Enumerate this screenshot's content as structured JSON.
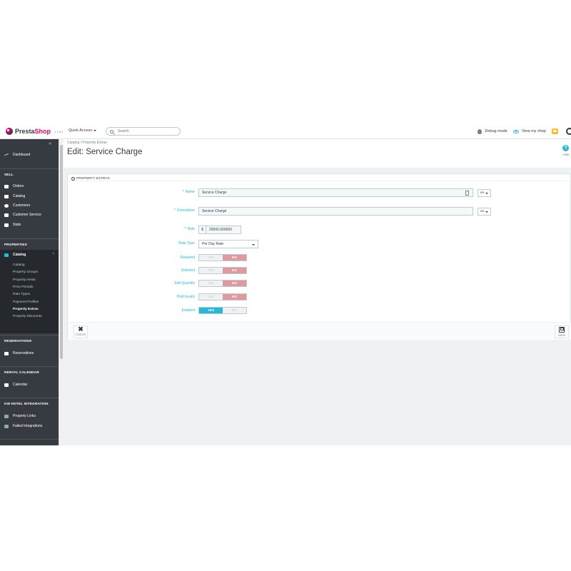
{
  "header": {
    "brand_presta": "Presta",
    "brand_shop": "Shop",
    "version": "1.7.4.2",
    "quick_access": "Quick Access",
    "search_placeholder": "Search",
    "debug_mode": "Debug mode",
    "view_shop": "View my shop"
  },
  "sidebar": {
    "collapse": "«",
    "dashboard": "Dashboard",
    "sell_title": "SELL",
    "sell_items": [
      "Orders",
      "Catalog",
      "Customers",
      "Customer Service",
      "Stats"
    ],
    "properties_title": "PROPERTIES",
    "catalog_label": "Catalog",
    "catalog_chevron": "^",
    "catalog_sub": [
      "Catalog",
      "Property Groups",
      "Property Areas",
      "Price Periods",
      "Rate Types",
      "Payment Profiles",
      "Property Extras",
      "Property Discounts"
    ],
    "reservations_title": "RESERVATIONS",
    "reservations_item": "Reservations",
    "rental_title": "RENTAL CALENDAR",
    "calendar_item": "Calendar",
    "kw_title": "KW HOTEL INTEGRATION",
    "kw_items": [
      "Property Links",
      "Failed Integrations"
    ]
  },
  "page": {
    "breadcrumb_parent": "Catalog",
    "breadcrumb_sep": "/",
    "breadcrumb_current": "Property Extras",
    "title": "Edit: Service Charge",
    "help_icon": "?",
    "help_label": "Help"
  },
  "form": {
    "panel_title": "PROPERTY EXTRAS",
    "required_mark": "*",
    "name_label": "Name",
    "name_value": "Service Charge",
    "description_label": "Description",
    "description_value": "Service Charge",
    "lang": "en",
    "rate_label": "Rate",
    "currency": "$",
    "rate_value": "20000.000000",
    "rate_type_label": "Rate Type",
    "rate_type_value": "Per Day Rate",
    "switch_yes": "YES",
    "switch_no": "NO",
    "required_label": "Required",
    "selected_label": "Selected",
    "edit_quantity_label": "Edit Quantity",
    "paid_locally_label": "Paid locally",
    "enabled_label": "Enabled",
    "cancel_icon": "✖",
    "cancel_label": "Cancel",
    "save_label": "Save"
  },
  "colors": {
    "accent": "#25b9d7",
    "brand": "#df0067",
    "sidebar_bg": "#363a41",
    "switch_no_bg": "#e0999f"
  }
}
